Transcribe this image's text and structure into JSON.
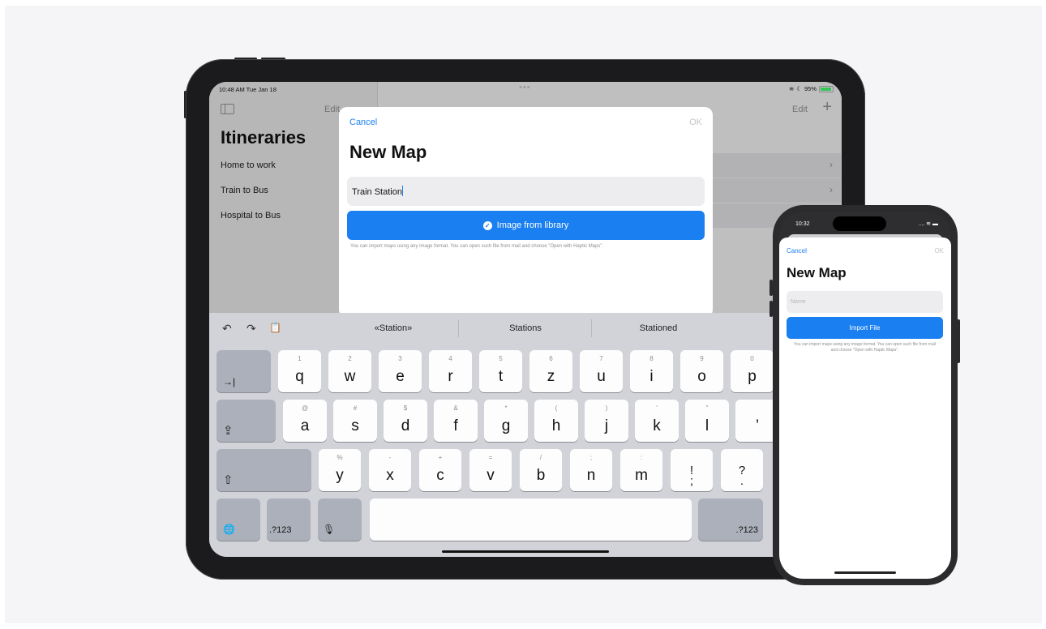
{
  "ipad": {
    "status": {
      "time": "10:48 AM  Tue Jan 18",
      "dots": "•••",
      "battery": "95%"
    },
    "sidebar": {
      "edit_label": "Edit",
      "title": "Itineraries",
      "items": [
        "Home to work",
        "Train to Bus",
        "Hospital to Bus"
      ]
    },
    "detail": {
      "edit_label": "Edit",
      "add_glyph": "+",
      "chevron": "›"
    },
    "modal": {
      "cancel_label": "Cancel",
      "ok_label": "OK",
      "title": "New Map",
      "name_value": "Train Station",
      "import_button_label": "Image from library",
      "hint": "You can import maps using any image format. You can open such file from mail and choose \"Open with Haptic Maps\"."
    },
    "keyboard": {
      "tools": {
        "undo": "↶",
        "redo": "↷",
        "paste": "📋"
      },
      "suggestions": [
        "«Station»",
        "Stations",
        "Stationed"
      ],
      "row1": [
        {
          "alt": "1",
          "main": "q"
        },
        {
          "alt": "2",
          "main": "w"
        },
        {
          "alt": "3",
          "main": "e"
        },
        {
          "alt": "4",
          "main": "r"
        },
        {
          "alt": "5",
          "main": "t"
        },
        {
          "alt": "6",
          "main": "z"
        },
        {
          "alt": "7",
          "main": "u"
        },
        {
          "alt": "8",
          "main": "i"
        },
        {
          "alt": "9",
          "main": "o"
        },
        {
          "alt": "0",
          "main": "p"
        }
      ],
      "row2": [
        {
          "alt": "@",
          "main": "a"
        },
        {
          "alt": "#",
          "main": "s"
        },
        {
          "alt": "$",
          "main": "d"
        },
        {
          "alt": "&",
          "main": "f"
        },
        {
          "alt": "*",
          "main": "g"
        },
        {
          "alt": "(",
          "main": "h"
        },
        {
          "alt": ")",
          "main": "j"
        },
        {
          "alt": "'",
          "main": "k"
        },
        {
          "alt": "\"",
          "main": "l"
        },
        {
          "alt": "",
          "main": "’"
        }
      ],
      "row3": [
        {
          "alt": "%",
          "main": "y"
        },
        {
          "alt": "-",
          "main": "x"
        },
        {
          "alt": "+",
          "main": "c"
        },
        {
          "alt": "=",
          "main": "v"
        },
        {
          "alt": "/",
          "main": "b"
        },
        {
          "alt": ";",
          "main": "n"
        },
        {
          "alt": ":",
          "main": "m"
        },
        {
          "alt": "",
          "main": "!\n;"
        },
        {
          "alt": "",
          "main": "?\n."
        }
      ],
      "tab_glyph": "→|",
      "caps_glyph": "⇪",
      "shift_glyph": "⇧",
      "globe_glyph": "🌐",
      "mic_glyph": "🎙",
      "numbers_label": ".?123",
      "numbers_right_label": ".?123"
    }
  },
  "iphone": {
    "status": {
      "time": "10:32",
      "right": "....  ≋ ▬"
    },
    "sheet": {
      "cancel_label": "Cancel",
      "ok_label": "OK",
      "title": "New Map",
      "name_placeholder": "Name",
      "import_button_label": "Import File",
      "hint": "You can import maps using any image format. You can open such file from mail and choose \"Open with Haptic Maps\"."
    }
  },
  "colors": {
    "accent": "#1a7ff0",
    "keyboard_bg": "#d1d3d9",
    "key_dark": "#acb0ba"
  }
}
